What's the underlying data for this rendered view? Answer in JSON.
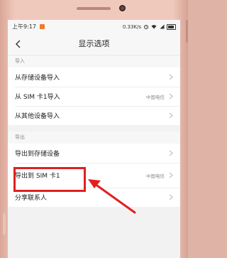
{
  "status_bar": {
    "time": "上午9:17",
    "network_speed": "0.33K/s",
    "battery_level": 0.85
  },
  "header": {
    "title": "显示选项"
  },
  "import_section": {
    "header": "导入",
    "items": [
      {
        "label": "从存储设备导入",
        "sub": ""
      },
      {
        "label": "从 SIM 卡1导入",
        "sub": "中国电信"
      },
      {
        "label": "从其他设备导入",
        "sub": ""
      }
    ]
  },
  "export_section": {
    "header": "导出",
    "items": [
      {
        "label": "导出到存储设备",
        "sub": ""
      },
      {
        "label": "导出到 SIM 卡1",
        "sub": "中国电信"
      },
      {
        "label": "分享联系人",
        "sub": ""
      }
    ]
  },
  "colors": {
    "highlight": "#e0201f",
    "notification": "#f07a2a"
  }
}
